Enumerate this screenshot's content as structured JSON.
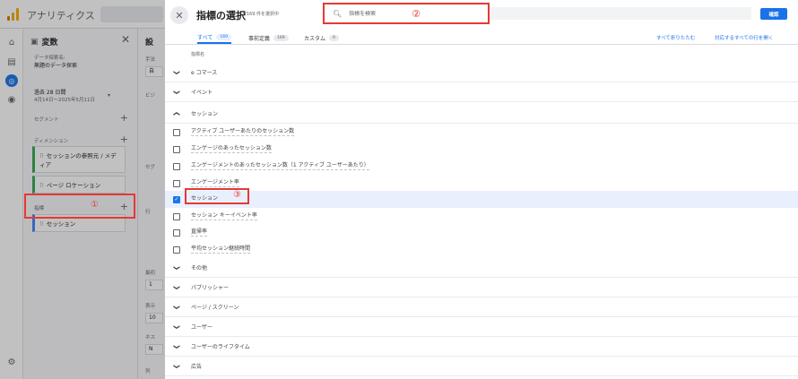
{
  "app": {
    "title": "アナリティクス"
  },
  "variables_panel": {
    "title": "変数",
    "exploration_label": "データ探索名:",
    "exploration_name": "無題のデータ探索",
    "date_range_label": "過去 28 日間",
    "date_range": "4月14日～2025年5月11日",
    "segments_label": "セグメント",
    "dimensions_label": "ディメンション",
    "dimensions": [
      "セッションの参照元 / メディア",
      "ページ ロケーション"
    ],
    "metrics_label": "指標",
    "metrics": [
      "セッション"
    ]
  },
  "settings_panel": {
    "title_fragment": "設",
    "fragments": [
      "手法",
      "ビジ",
      "セグ",
      "行",
      "最初",
      "表示",
      "ネス",
      "列"
    ],
    "box_values": [
      "自",
      "1",
      "10",
      "N"
    ]
  },
  "annotations": {
    "marker_1": "①",
    "marker_2": "②",
    "marker_3": "③"
  },
  "dialog": {
    "title": "指標の選択",
    "subtitle": "1/169 件を選択中",
    "search_placeholder": "指標を検索",
    "confirm_label": "確認",
    "tabs": [
      {
        "label": "すべて",
        "count": "169"
      },
      {
        "label": "事前定義",
        "count": "169"
      },
      {
        "label": "カスタム",
        "count": "0"
      }
    ],
    "collapse_all_label": "すべて折りたたむ",
    "expand_matching_label": "対応するすべての行を開く",
    "column_header": "指標名",
    "categories_before": [
      "e コマース",
      "イベント"
    ],
    "expanded_category": "セッション",
    "session_items": [
      {
        "label": "アクティブ ユーザーあたりのセッション数",
        "checked": false
      },
      {
        "label": "エンゲージのあったセッション数",
        "checked": false
      },
      {
        "label": "エンゲージメントのあったセッション数（1 アクティブ ユーザーあたり）",
        "checked": false
      },
      {
        "label": "エンゲージメント率",
        "checked": false
      },
      {
        "label": "セッション",
        "checked": true
      },
      {
        "label": "セッション キーイベント率",
        "checked": false
      },
      {
        "label": "直帰率",
        "checked": false
      },
      {
        "label": "平均セッション継続時間",
        "checked": false
      }
    ],
    "categories_after": [
      "その他",
      "パブリッシャー",
      "ページ / スクリーン",
      "ユーザー",
      "ユーザーのライフタイム",
      "広告"
    ]
  }
}
